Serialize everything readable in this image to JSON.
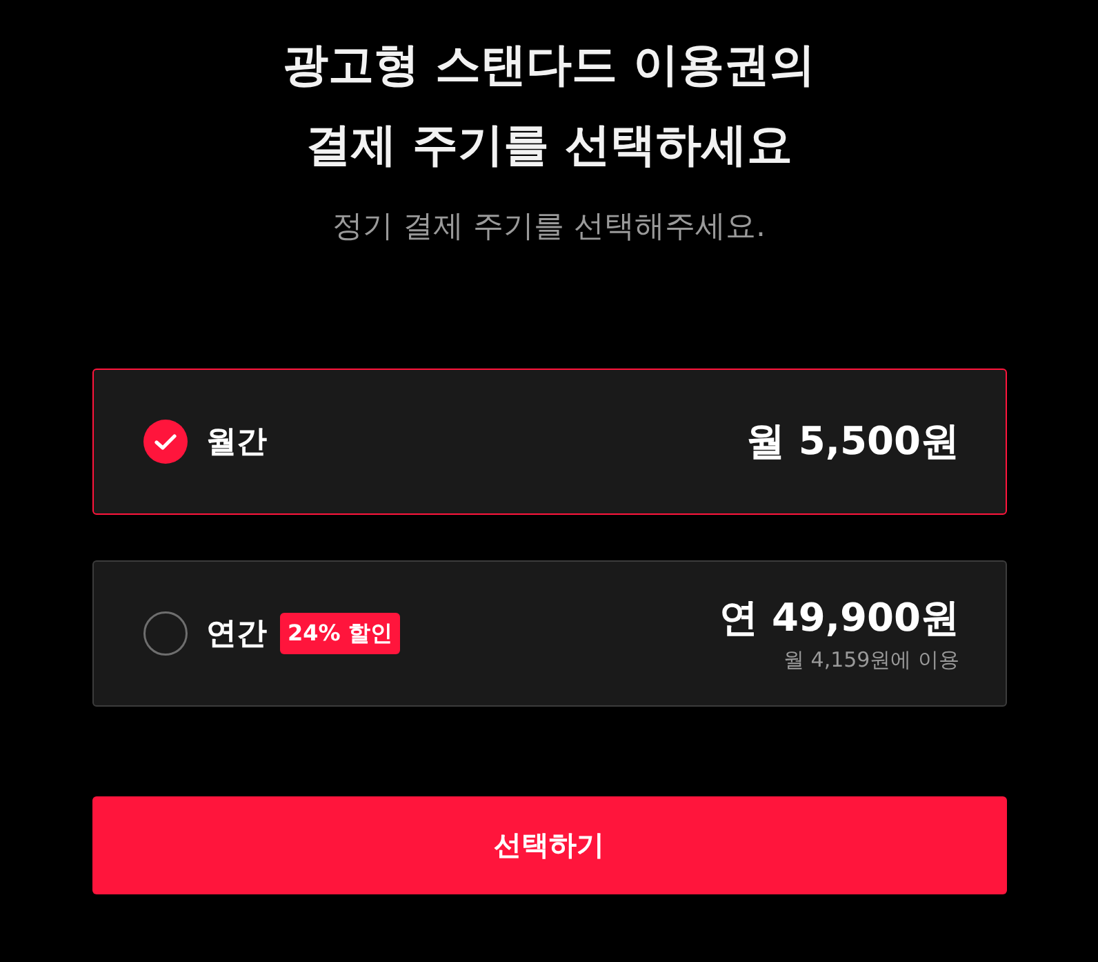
{
  "title_lines": [
    "광고형 스탠다드 이용권의",
    "결제 주기를 선택하세요"
  ],
  "subtitle": "정기 결제 주기를 선택해주세요.",
  "plans": [
    {
      "label": "월간",
      "selected": true,
      "price": "월 5,500원"
    },
    {
      "label": "연간",
      "selected": false,
      "badge": "24% 할인",
      "price": "연 49,900원",
      "note": "월 4,159원에 이용"
    }
  ],
  "submit_button": "선택하기"
}
